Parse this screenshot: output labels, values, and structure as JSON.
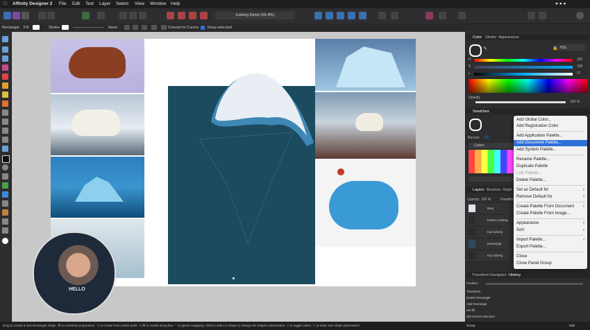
{
  "menubar": {
    "app_name": "Affinity Designer 2",
    "items": [
      "File",
      "Edit",
      "Text",
      "Layer",
      "Select",
      "View",
      "Window",
      "Help"
    ]
  },
  "document": {
    "title": "Iceberg Demo (65.4%)"
  },
  "context_toolbar": {
    "tool_name": "Rectangle",
    "fill_label": "Fill",
    "stroke_label": "Stroke",
    "stroke_style": "None",
    "convert_label": "Convert to Curves",
    "keep_selected_label": "Keep selected"
  },
  "color_panel": {
    "tabs": [
      "Color",
      "Stroke",
      "Appearance"
    ],
    "model": "HSL",
    "h_label": "H",
    "h_value": "192",
    "s_label": "S",
    "s_value": "100",
    "l_label": "L",
    "l_value": "27",
    "opacity_label": "Opacity",
    "opacity_value": "100 %"
  },
  "swatches_panel": {
    "tab": "Swatches",
    "recent_label": "Recent:",
    "palette_name": "Colors"
  },
  "context_menu": {
    "items": [
      {
        "label": "Add Global Color..."
      },
      {
        "label": "Add Registration Color"
      },
      {
        "label": "Add Application Palette..."
      },
      {
        "label": "Add Document Palette...",
        "highlighted": true
      },
      {
        "label": "Add System Palette..."
      },
      {
        "label": "Rename Palette..."
      },
      {
        "label": "Duplicate Palette"
      },
      {
        "label": "Link Palette...",
        "disabled": true
      },
      {
        "label": "Delete Palette..."
      },
      {
        "label": "Set as Default for",
        "submenu": true
      },
      {
        "label": "Remove Default for",
        "submenu": true
      },
      {
        "label": "Create Palette From Document",
        "submenu": true
      },
      {
        "label": "Create Palette From Image..."
      },
      {
        "label": "Appearance",
        "submenu": true
      },
      {
        "label": "Sort",
        "submenu": true
      },
      {
        "label": "Import Palette...",
        "submenu": true
      },
      {
        "label": "Export Palette..."
      },
      {
        "label": "Close"
      },
      {
        "label": "Close Panel Group"
      }
    ]
  },
  "layers_panel": {
    "tabs": [
      "Layers",
      "Brushes",
      "Glyph Br"
    ],
    "opacity_label": "Opacity:",
    "opacity_value": "100 %",
    "blend_mode": "Passthro",
    "layers": [
      "Bear",
      "bottom iceberg",
      "top iceberg",
      "Rectangle",
      "top iceberg"
    ]
  },
  "bottom_panel": {
    "tabs": [
      "Transform",
      "Navigator",
      "History"
    ],
    "position_label": "Position:",
    "history": [
      "Transform",
      "Delete Rectangle",
      "Add Rectangle",
      "Set fill",
      "Set current selection"
    ],
    "group_label": "Group",
    "zoom_value": "Edit"
  },
  "statusbar": {
    "hint": "Drag to create a new Rectangle shape. ⌘ to constrain proportions. ⌥ to create from center point. ⌥⌘ to create along line. ⌃ to ignore snapping. Click to select a shape to change the shape's parameters. ⇧ to toggle select. ⇧ to enter new shape parameters"
  },
  "webcam": {
    "shirt_text": "HELLO"
  }
}
